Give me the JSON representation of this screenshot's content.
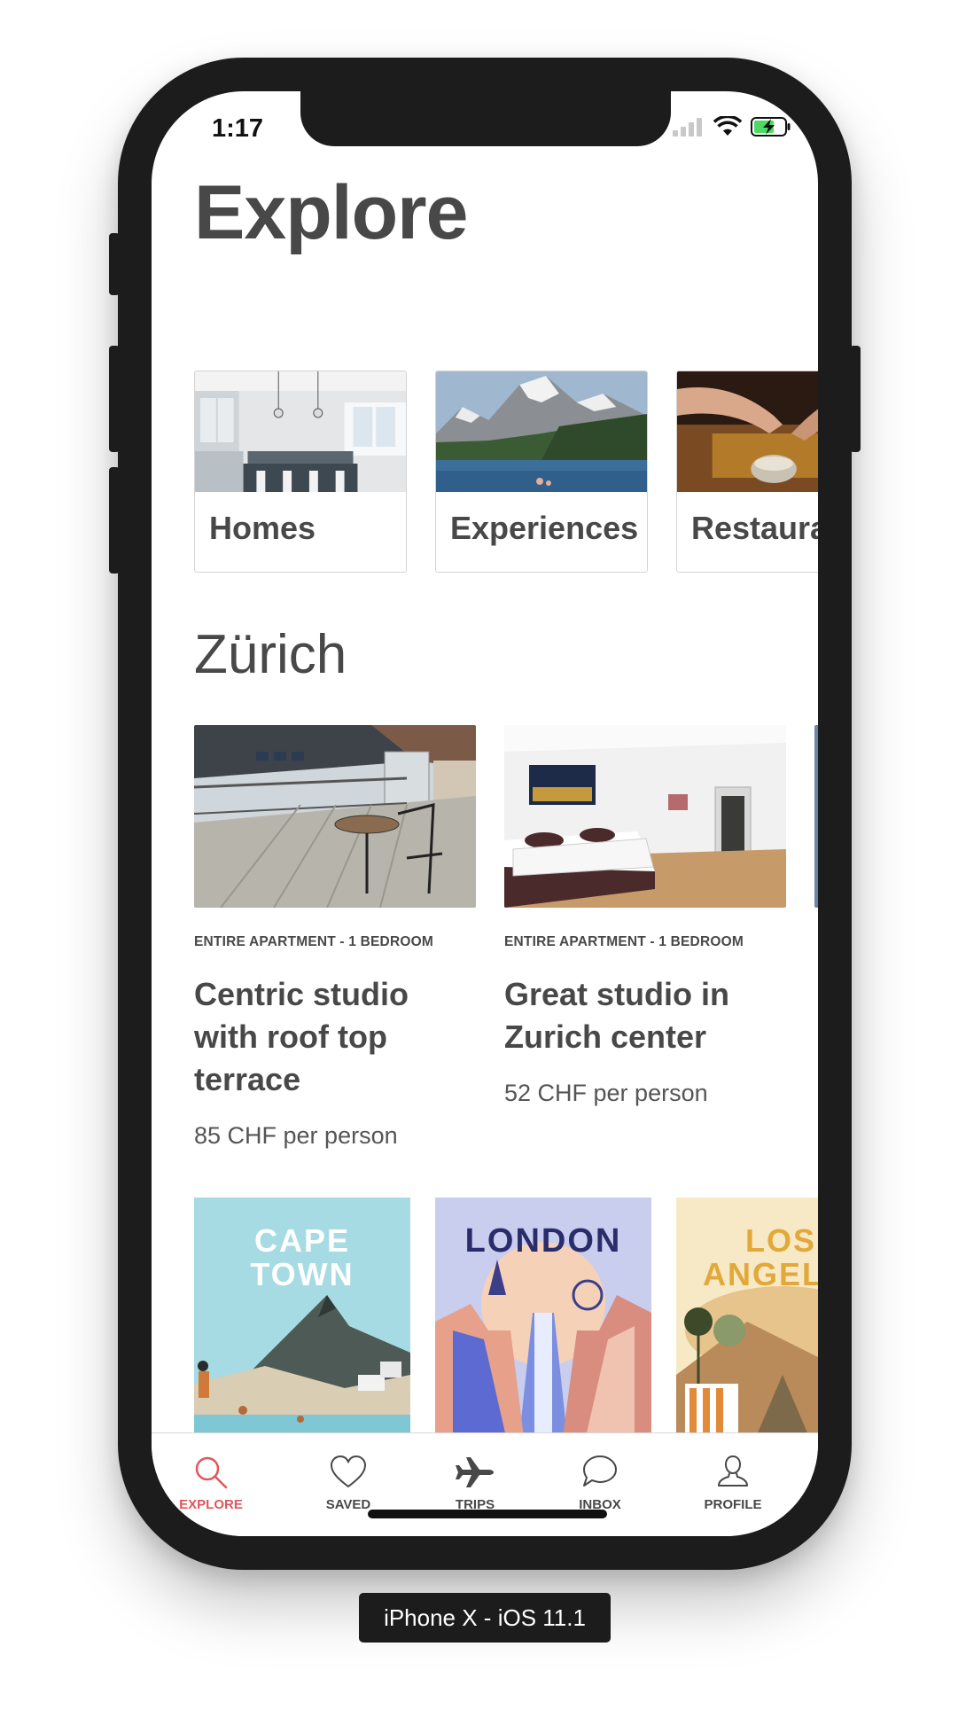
{
  "status_bar": {
    "time": "1:17"
  },
  "page": {
    "title": "Explore"
  },
  "categories": [
    {
      "label": "Homes"
    },
    {
      "label": "Experiences"
    },
    {
      "label": "Restaurants"
    }
  ],
  "section": {
    "title": "Zürich"
  },
  "listings": [
    {
      "kind": "ENTIRE APARTMENT - 1 BEDROOM",
      "title": "Centric studio with roof top terrace",
      "price": "85 CHF per person"
    },
    {
      "kind": "ENTIRE APARTMENT - 1 BEDROOM",
      "title": "Great studio in Zurich center",
      "price": "52 CHF per person"
    }
  ],
  "cities": [
    {
      "name_line1": "CAPE",
      "name_line2": "TOWN"
    },
    {
      "name_line1": "LONDON"
    },
    {
      "name_line1": "LOS",
      "name_line2": "ANGELES"
    }
  ],
  "tabbar": {
    "explore": "EXPLORE",
    "saved": "SAVED",
    "trips": "TRIPS",
    "inbox": "INBOX",
    "profile": "PROFILE",
    "active_color": "#e0565b"
  },
  "device_label": "iPhone X - iOS 11.1"
}
